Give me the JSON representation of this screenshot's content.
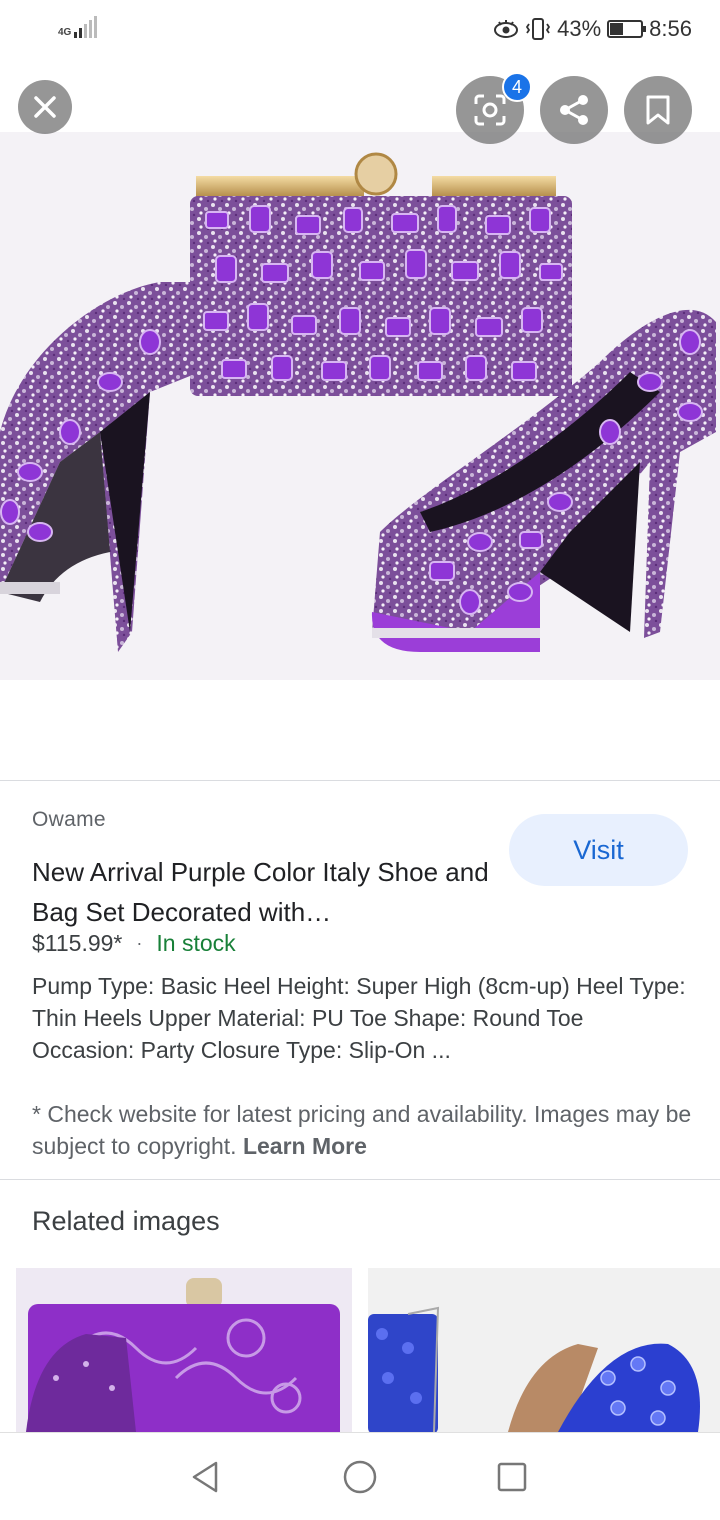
{
  "status_bar": {
    "network": "4G",
    "battery_percent": "43%",
    "battery_level": 0.43,
    "time": "8:56"
  },
  "overlay": {
    "lens_badge_count": "4"
  },
  "result": {
    "source": "Owame",
    "title": "New Arrival Purple Color Italy Shoe and Bag Set Decorated with…",
    "price": "$115.99*",
    "separator": "·",
    "availability": "In stock",
    "visit_label": "Visit",
    "description": "Pump Type: Basic Heel Height: Super High (8cm-up) Heel Type: Thin Heels Upper Material: PU Toe Shape: Round Toe Occasion: Party Closure Type: Slip-On ...",
    "disclaimer": "* Check website for latest pricing and availability. Images may be subject to copyright.",
    "learn_more": "Learn More"
  },
  "related": {
    "heading": "Related images"
  },
  "colors": {
    "accent_blue": "#1a73e8",
    "visit_bg": "#e8f0fe",
    "in_stock_green": "#188038",
    "purple_product": "#8e35d6",
    "blue_product": "#2745d8"
  }
}
